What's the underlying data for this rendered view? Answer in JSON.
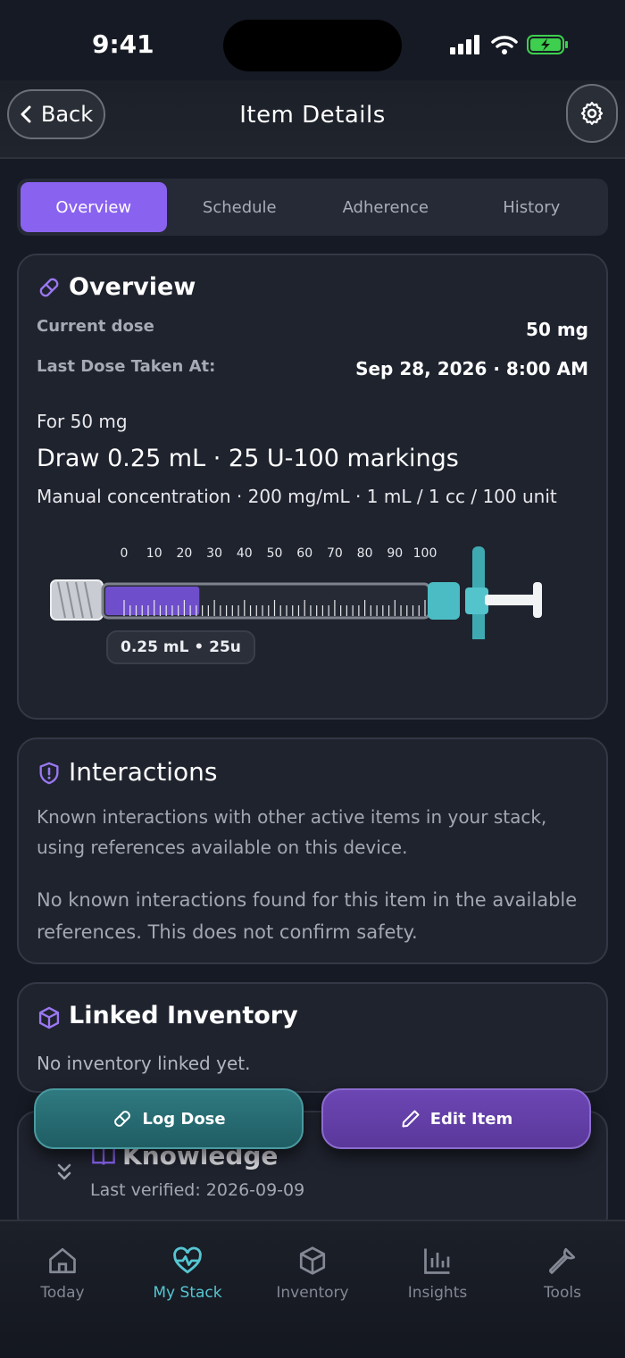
{
  "status": {
    "time": "9:41"
  },
  "header": {
    "back_label": "Back",
    "title": "Item Details"
  },
  "tabs": [
    {
      "label": "Overview",
      "active": true
    },
    {
      "label": "Schedule",
      "active": false
    },
    {
      "label": "Adherence",
      "active": false
    },
    {
      "label": "History",
      "active": false
    }
  ],
  "overview": {
    "title": "Overview",
    "current_dose_label": "Current dose",
    "current_dose_value": "50 mg",
    "last_dose_label": "Last Dose Taken At:",
    "last_dose_value": "Sep 28, 2026 · 8:00 AM",
    "for_dose": "For 50 mg",
    "draw": "Draw 0.25 mL · 25 U-100 markings",
    "concentration": "Manual concentration · 200 mg/mL · 1 mL / 1 cc / 100 unit",
    "syringe_ticks": [
      "0",
      "10",
      "20",
      "30",
      "40",
      "50",
      "60",
      "70",
      "80",
      "90",
      "100"
    ],
    "fill_units": 25,
    "fill_color": "#7d55e6",
    "dose_pill": "0.25 mL • 25u"
  },
  "interactions": {
    "title": "Interactions",
    "description": "Known interactions with other active items in your stack, using references available on this device.",
    "status": "No known interactions found for this item in the available references. This does not confirm safety."
  },
  "inventory": {
    "title": "Linked Inventory",
    "status": "No inventory linked yet."
  },
  "knowledge": {
    "title": "Knowledge",
    "verified": "Last verified: 2026-09-09"
  },
  "actions": {
    "log_label": "Log Dose",
    "edit_label": "Edit Item"
  },
  "tabbar": [
    {
      "label": "Today",
      "icon": "home-icon",
      "active": false
    },
    {
      "label": "My Stack",
      "icon": "heart-pulse-icon",
      "active": true
    },
    {
      "label": "Inventory",
      "icon": "box-icon",
      "active": false
    },
    {
      "label": "Insights",
      "icon": "bar-chart-icon",
      "active": false
    },
    {
      "label": "Tools",
      "icon": "wrench-icon",
      "active": false
    }
  ],
  "colors": {
    "accent": "#8a62f0",
    "teal": "#55c6d2",
    "background": "#161a24",
    "card": "#1f232e"
  }
}
